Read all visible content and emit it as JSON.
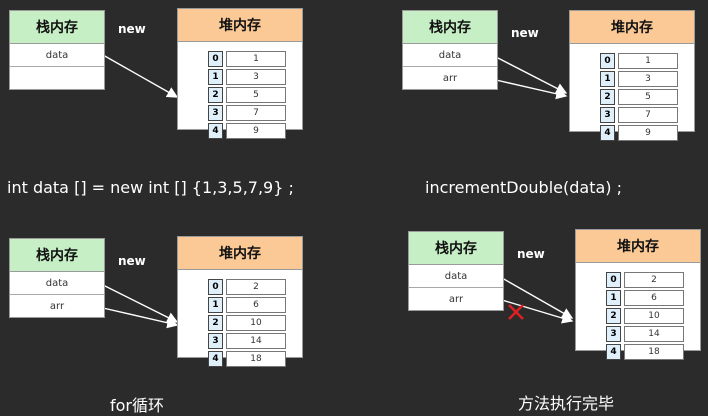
{
  "stack_title": "栈内存",
  "heap_title": "堆内存",
  "new_label": "new",
  "panels": [
    {
      "stack_rows": [
        "data",
        ""
      ],
      "heap_values": [
        "1",
        "3",
        "5",
        "7",
        "9"
      ],
      "caption": "int data [] = new int [] {1,3,5,7,9} ;"
    },
    {
      "stack_rows": [
        "data",
        "arr"
      ],
      "heap_values": [
        "1",
        "3",
        "5",
        "7",
        "9"
      ],
      "caption": "incrementDouble(data) ;"
    },
    {
      "stack_rows": [
        "data",
        "arr"
      ],
      "heap_values": [
        "2",
        "6",
        "10",
        "14",
        "18"
      ],
      "caption": "for循环"
    },
    {
      "stack_rows": [
        "data",
        "arr"
      ],
      "heap_values": [
        "2",
        "6",
        "10",
        "14",
        "18"
      ],
      "caption": "方法执行完毕"
    }
  ],
  "indices": [
    "0",
    "1",
    "2",
    "3",
    "4"
  ],
  "colors": {
    "background": "#2b2b2b",
    "stack_header": "#c6efc6",
    "heap_header": "#fbc996",
    "index_cell": "#dff0fa",
    "wire": "#ffffff",
    "cut_mark": "#e02020"
  },
  "icons": [
    "cross-mark-icon"
  ]
}
